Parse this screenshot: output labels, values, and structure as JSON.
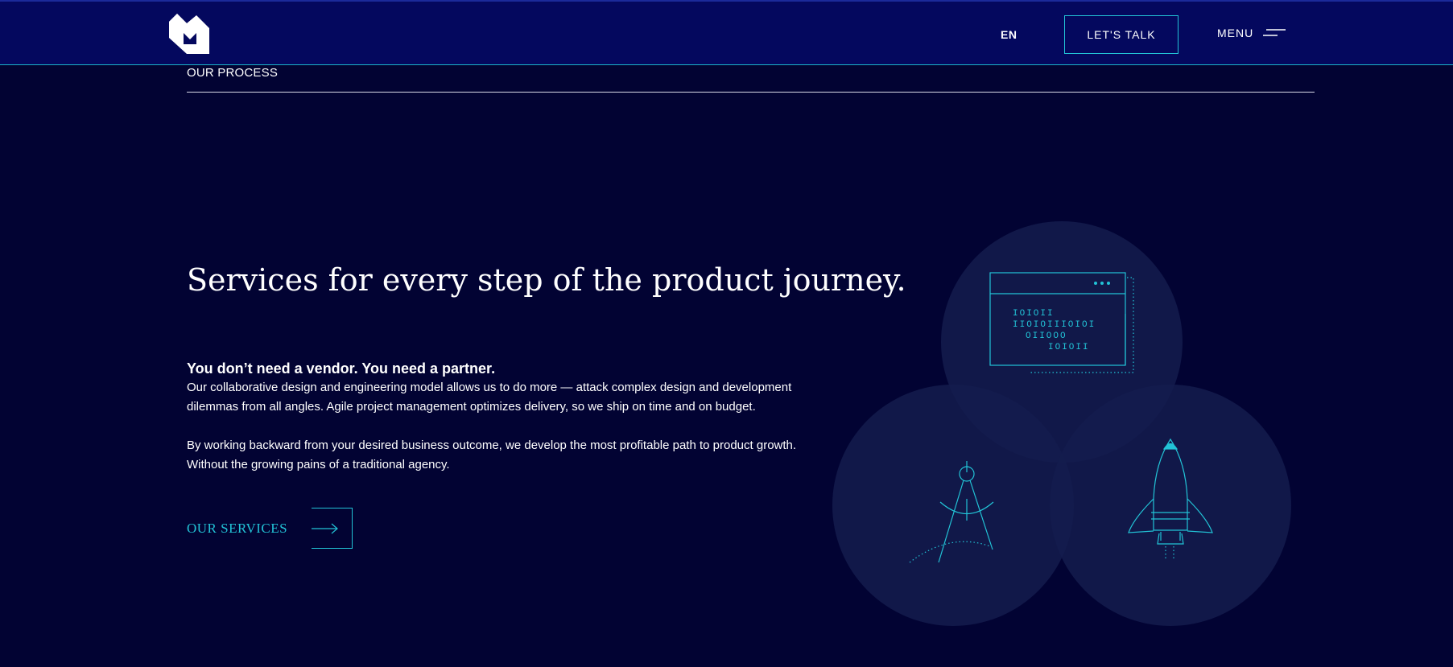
{
  "header": {
    "logo_icon": "brand-logo-icon",
    "language": "EN",
    "cta_label": "LET'S TALK",
    "menu_label": "MENU",
    "menu_icon": "hamburger-menu-icon"
  },
  "section": {
    "eyebrow": "OUR PROCESS",
    "headline": "Services for every step of the product journey.",
    "subhead": "You don’t need a vendor. You need a partner.",
    "paragraphs": [
      "Our collaborative design and engineering model allows us to do more — attack complex design and development dilemmas from all angles. Agile project management optimizes delivery, so we ship on time and on budget.",
      "By working backward from your desired business outcome, we develop the most profitable path to product growth. Without the growing pains of a traditional agency."
    ],
    "link_label": "OUR SERVICES",
    "link_icon": "arrow-right-icon"
  },
  "illustration": {
    "icons": [
      "code-window-icon",
      "drafting-compass-icon",
      "rocket-icon"
    ],
    "code_lines": [
      "IOIOII",
      "IIOIOIIIOIOI",
      "OIIOOO",
      "IOIOII"
    ]
  },
  "colors": {
    "background": "#020333",
    "header_background": "#04085e",
    "accent": "#22c3d6",
    "circle_fill": "#141c4e"
  }
}
